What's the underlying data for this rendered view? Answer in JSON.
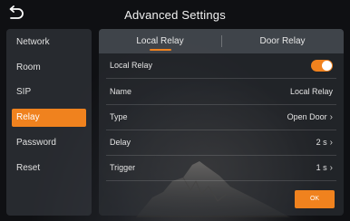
{
  "header": {
    "title": "Advanced Settings",
    "back_icon": "back-arrow-icon"
  },
  "sidebar": {
    "items": [
      {
        "label": "Network",
        "active": false
      },
      {
        "label": "Room",
        "active": false
      },
      {
        "label": "SIP",
        "active": false
      },
      {
        "label": "Relay",
        "active": true
      },
      {
        "label": "Password",
        "active": false
      },
      {
        "label": "Reset",
        "active": false
      }
    ]
  },
  "tabs": [
    {
      "label": "Local Relay",
      "active": true
    },
    {
      "label": "Door Relay",
      "active": false
    }
  ],
  "settings": {
    "local_relay": {
      "label": "Local Relay",
      "enabled": true
    },
    "name": {
      "label": "Name",
      "value": "Local Relay"
    },
    "type": {
      "label": "Type",
      "value": "Open Door"
    },
    "delay": {
      "label": "Delay",
      "value": "2 s"
    },
    "trigger": {
      "label": "Trigger",
      "value": "1 s"
    }
  },
  "ok_label": "OK",
  "colors": {
    "accent": "#f0821e",
    "background": "#111215"
  }
}
